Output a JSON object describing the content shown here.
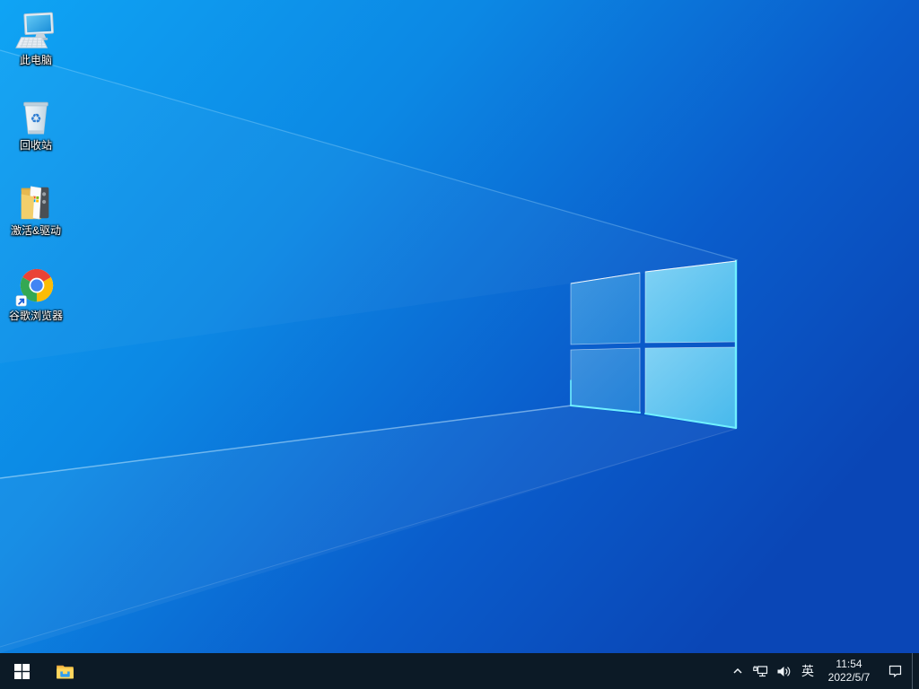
{
  "colors": {
    "taskbar_bg": "#0c1a26",
    "wallpaper_top_left": "#0da2f2",
    "wallpaper_bottom_right": "#0a46b6",
    "logo_pane": "#5fc9f2",
    "logo_edge_glow": "#70f0ff"
  },
  "desktop": {
    "icons": [
      {
        "name": "this-pc",
        "label": "此电脑"
      },
      {
        "name": "recycle-bin",
        "label": "回收站"
      },
      {
        "name": "activation-and-drivers-folder",
        "label": "激活&驱动"
      },
      {
        "name": "google-chrome",
        "label": "谷歌浏览器"
      }
    ]
  },
  "taskbar": {
    "buttons": [
      {
        "name": "start"
      },
      {
        "name": "file-explorer"
      }
    ],
    "tray": {
      "icons": [
        "hidden-icons-chevron",
        "network",
        "volume",
        "language-indicator",
        "clock",
        "action-center",
        "show-desktop"
      ],
      "language": "英",
      "time": "11:54",
      "date": "2022/5/7"
    }
  }
}
